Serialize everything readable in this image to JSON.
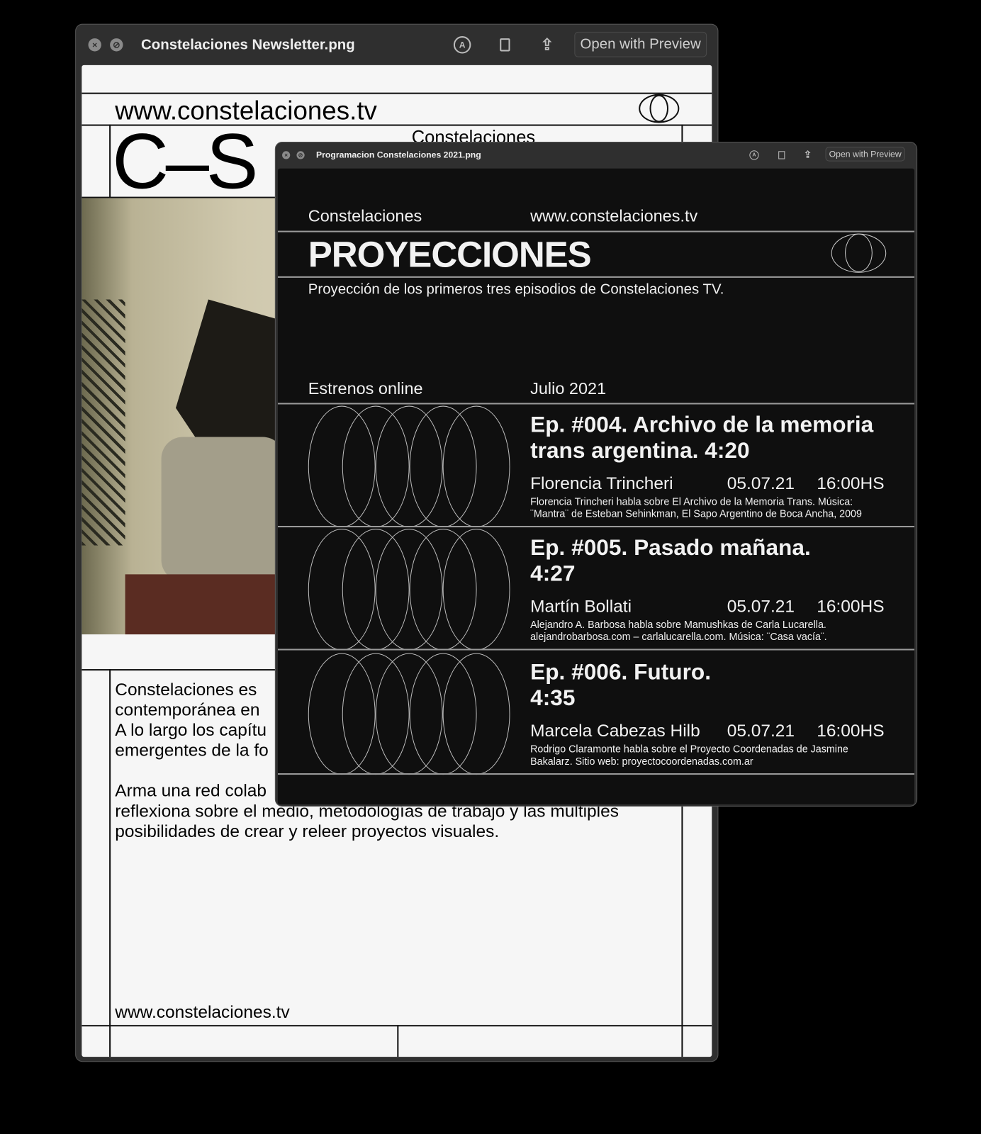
{
  "window_back": {
    "title": "Constelaciones Newsletter.png",
    "open_label": "Open with Preview",
    "content": {
      "url_top": "www.constelaciones.tv",
      "logo": "C–S",
      "brand": "Constelaciones",
      "paragraph1": [
        "Constelaciones es",
        "contemporánea en",
        "A lo largo los capítu",
        "emergentes de la fo"
      ],
      "paragraph2": [
        "Arma una red colab",
        "reflexiona sobre el medio, metodologías de trabajo y las múltiples",
        "posibilidades de crear y releer proyectos visuales."
      ],
      "url_bottom": "www.constelaciones.tv"
    }
  },
  "window_front": {
    "title": "Programacion Constelaciones 2021.png",
    "open_label": "Open with Preview",
    "content": {
      "brand": "Constelaciones",
      "url": "www.constelaciones.tv",
      "heading": "PROYECCIONES",
      "subtitle": "Proyección de los primeros tres episodios de Constelaciones TV.",
      "section_left": "Estrenos online",
      "section_right": "Julio 2021",
      "episodes": [
        {
          "title1": "Ep. #004. Archivo de la memoria",
          "title2": "trans argentina. 4:20",
          "person": "Florencia Trincheri",
          "date": "05.07.21",
          "time": "16:00HS",
          "desc1": "Florencia Trincheri habla sobre El Archivo de la Memoria Trans. Música:",
          "desc2": "¨Mantra¨ de Esteban Sehinkman, El Sapo Argentino de Boca Ancha, 2009"
        },
        {
          "title1": "Ep. #005. Pasado mañana.",
          "title2": "4:27",
          "person": "Martín Bollati",
          "date": "05.07.21",
          "time": "16:00HS",
          "desc1": "Alejandro A. Barbosa habla sobre Mamushkas de Carla Lucarella.",
          "desc2": "alejandrobarbosa.com – carlalucarella.com. Música: ¨Casa vacía¨."
        },
        {
          "title1": "Ep. #006. Futuro.",
          "title2": "4:35",
          "person": "Marcela Cabezas Hilb",
          "date": "05.07.21",
          "time": "16:00HS",
          "desc1": "Rodrigo Claramonte habla sobre el Proyecto Coordenadas de Jasmine",
          "desc2": "Bakalarz. Sitio web: proyectocoordenadas.com.ar"
        }
      ]
    }
  },
  "icons": [
    "close-icon",
    "slash-icon",
    "markup-icon",
    "rotate-icon",
    "share-icon",
    "globe-logo-icon"
  ]
}
